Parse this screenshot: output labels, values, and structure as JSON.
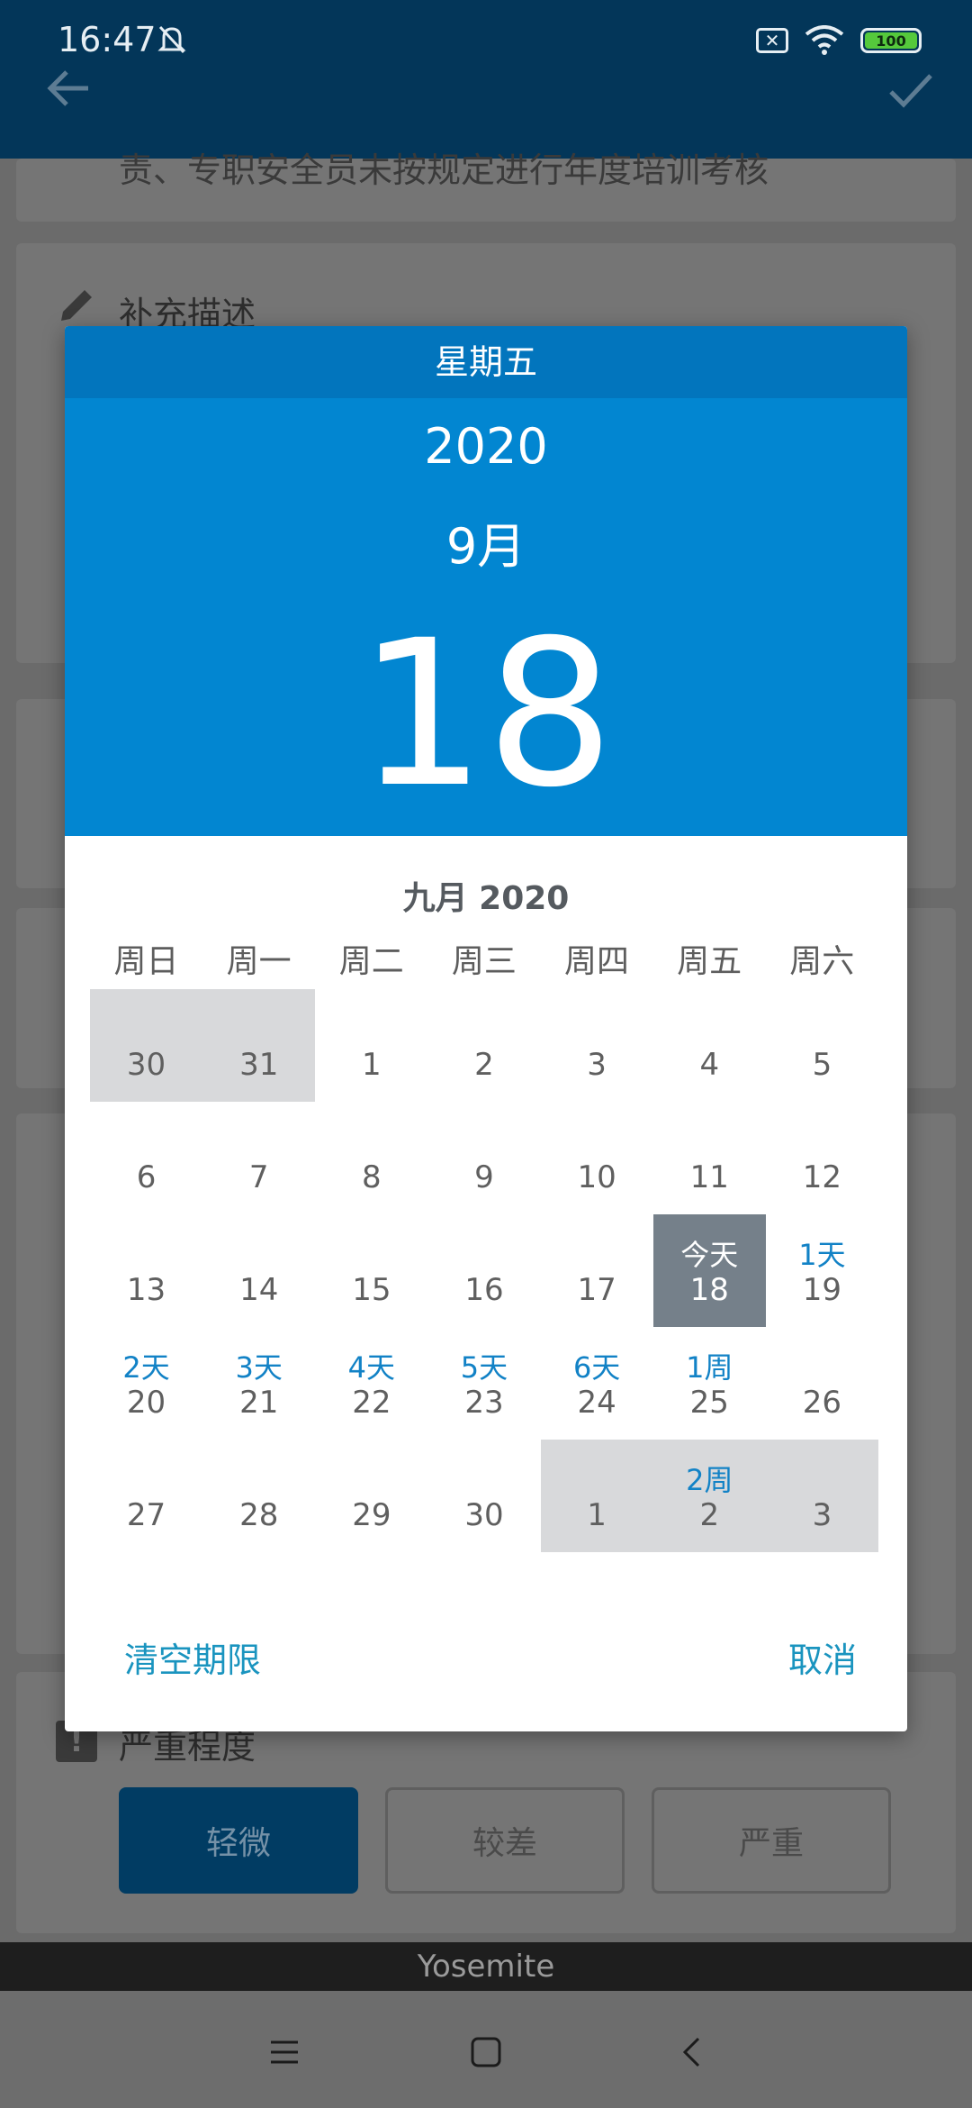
{
  "status": {
    "time": "16:47",
    "battery": "100"
  },
  "background": {
    "line1": "责、专职安全员未按规定进行年度培训考核",
    "supplement_label": "补充描述",
    "severity_label": "严重程度",
    "severity_options": [
      "轻微",
      "较差",
      "严重"
    ],
    "footer": "Yosemite"
  },
  "dialog": {
    "weekday": "星期五",
    "year": "2020",
    "month": "9月",
    "day": "18",
    "calendar_title": "九月 2020",
    "weekday_headers": [
      "周日",
      "周一",
      "周二",
      "周三",
      "周四",
      "周五",
      "周六"
    ],
    "weeks": [
      [
        {
          "n": "30",
          "style": "grey"
        },
        {
          "n": "31",
          "style": "grey"
        },
        {
          "n": "1"
        },
        {
          "n": "2"
        },
        {
          "n": "3"
        },
        {
          "n": "4"
        },
        {
          "n": "5"
        }
      ],
      [
        {
          "n": "6"
        },
        {
          "n": "7"
        },
        {
          "n": "8"
        },
        {
          "n": "9"
        },
        {
          "n": "10"
        },
        {
          "n": "11"
        },
        {
          "n": "12"
        }
      ],
      [
        {
          "n": "13"
        },
        {
          "n": "14"
        },
        {
          "n": "15"
        },
        {
          "n": "16"
        },
        {
          "n": "17"
        },
        {
          "n": "18",
          "tag": "今天",
          "style": "today"
        },
        {
          "n": "19",
          "tag": "1天"
        }
      ],
      [
        {
          "n": "20",
          "tag": "2天"
        },
        {
          "n": "21",
          "tag": "3天"
        },
        {
          "n": "22",
          "tag": "4天"
        },
        {
          "n": "23",
          "tag": "5天"
        },
        {
          "n": "24",
          "tag": "6天"
        },
        {
          "n": "25",
          "tag": "1周"
        },
        {
          "n": "26"
        }
      ],
      [
        {
          "n": "27"
        },
        {
          "n": "28"
        },
        {
          "n": "29"
        },
        {
          "n": "30"
        },
        {
          "n": "1",
          "style": "grey"
        },
        {
          "n": "2",
          "tag": "2周",
          "style": "grey"
        },
        {
          "n": "3",
          "style": "grey"
        }
      ]
    ],
    "clear_label": "清空期限",
    "cancel_label": "取消"
  },
  "colors": {
    "header_dark": "#033659",
    "dialog_blue": "#0286d1",
    "dialog_blue_dark": "#0275bd",
    "tag_blue": "#1282c6",
    "action_blue": "#1a94bf",
    "today_bg": "#75808a",
    "grey_cell": "#d8d9db"
  }
}
